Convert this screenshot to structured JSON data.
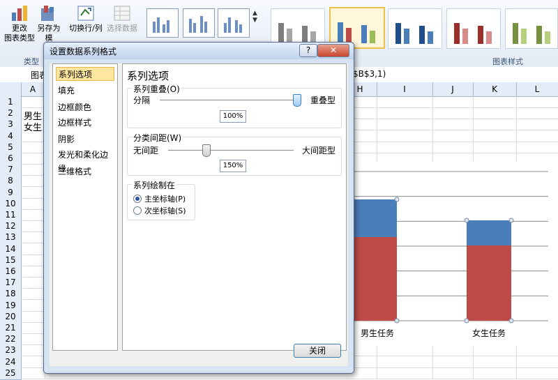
{
  "ribbon": {
    "change_type_label_1": "更改",
    "change_type_label_2": "图表类型",
    "save_as_label_1": "另存为",
    "save_as_label_2": "模",
    "switch_rowcol_label": "切换行/列",
    "select_data_label": "选择数据",
    "group_type_label": "类型",
    "group_styles_label": "图表样式"
  },
  "formula_bar": {
    "name_box": "图表",
    "formula": "$B$3,1)"
  },
  "columns": [
    "A",
    "H",
    "I",
    "J",
    "K",
    "L"
  ],
  "rows": [
    "1",
    "2",
    "3",
    "4",
    "5",
    "6",
    "7",
    "8",
    "9",
    "10",
    "11",
    "12",
    "13",
    "14",
    "15",
    "16",
    "17",
    "18",
    "19",
    "20",
    "21",
    "22",
    "23",
    "24",
    "25"
  ],
  "cells": {
    "a2": "男生",
    "a3": "女生"
  },
  "chart_data": {
    "type": "bar",
    "categories": [
      "男生任务",
      "女生任务"
    ],
    "series": [
      {
        "values": [
          0.45,
          0.3
        ],
        "color": "#4a7ebb"
      },
      {
        "values": [
          1.0,
          0.9
        ],
        "color": "#be4b48"
      }
    ],
    "stacked": true,
    "grid": true
  },
  "dialog": {
    "title": "设置数据系列格式",
    "help": "?",
    "close_x": "✕",
    "nav": [
      "系列选项",
      "填充",
      "边框颜色",
      "边框样式",
      "阴影",
      "发光和柔化边缘",
      "三维格式"
    ],
    "content_title": "系列选项",
    "overlap_group": "系列重叠(O)",
    "overlap_left": "分隔",
    "overlap_right": "重叠型",
    "overlap_value": "100%",
    "overlap_level": 1.0,
    "gap_group": "分类间距(W)",
    "gap_left": "无间距",
    "gap_right": "大间距型",
    "gap_value": "150%",
    "gap_level": 0.3,
    "plot_group": "系列绘制在",
    "primary_axis": "主坐标轴(P)",
    "secondary_axis": "次坐标轴(S)",
    "close_button": "关闭"
  }
}
